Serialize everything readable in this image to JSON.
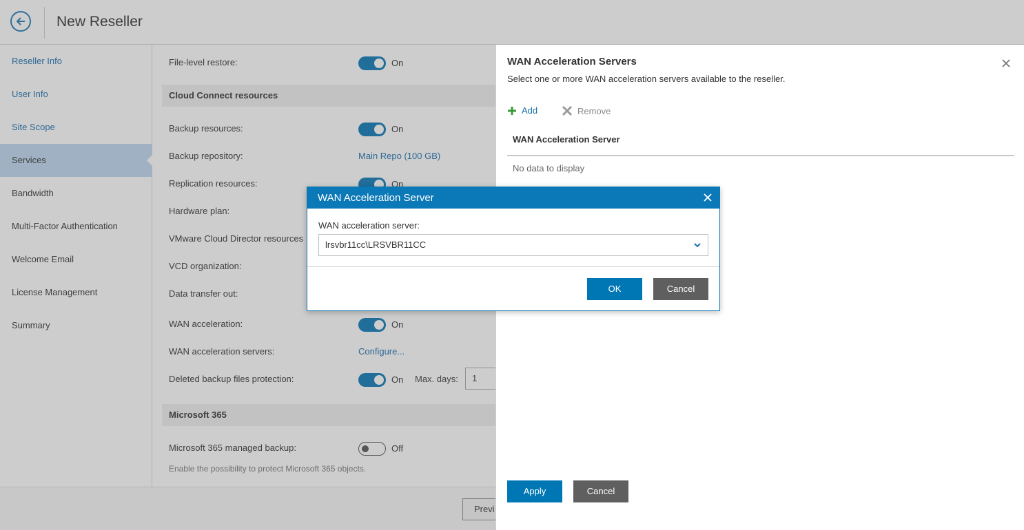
{
  "header": {
    "title": "New Reseller"
  },
  "sidebar": {
    "items": [
      {
        "label": "Reseller Info"
      },
      {
        "label": "User Info"
      },
      {
        "label": "Site Scope"
      },
      {
        "label": "Services"
      },
      {
        "label": "Bandwidth"
      },
      {
        "label": "Multi-Factor Authentication"
      },
      {
        "label": "Welcome Email"
      },
      {
        "label": "License Management"
      },
      {
        "label": "Summary"
      }
    ]
  },
  "form": {
    "file_level_restore": {
      "label": "File-level restore:",
      "state": "On"
    },
    "cloud_connect_header": "Cloud Connect resources",
    "backup_resources": {
      "label": "Backup resources:",
      "state": "On"
    },
    "backup_repository": {
      "label": "Backup repository:",
      "value": "Main Repo (100 GB)"
    },
    "replication_resources": {
      "label": "Replication resources:",
      "state": "On"
    },
    "hardware_plan": {
      "label": "Hardware plan:"
    },
    "vcd_resources": {
      "label": "VMware Cloud Director resources"
    },
    "vcd_organization": {
      "label": "VCD organization:"
    },
    "data_transfer_out": {
      "label": "Data transfer out:"
    },
    "wan_acceleration": {
      "label": "WAN acceleration:",
      "state": "On"
    },
    "wan_acceleration_servers": {
      "label": "WAN acceleration servers:",
      "link": "Configure..."
    },
    "deleted_backup_protection": {
      "label": "Deleted backup files protection:",
      "state": "On",
      "max_days_label": "Max. days:",
      "max_days_value": "1"
    },
    "m365_header": "Microsoft 365",
    "m365_managed_backup": {
      "label": "Microsoft 365 managed backup:",
      "state": "Off"
    },
    "m365_hint": "Enable the possibility to protect Microsoft 365 objects."
  },
  "footer": {
    "previous_label": "Previ"
  },
  "side_panel": {
    "title": "WAN Acceleration Servers",
    "description": "Select one or more WAN acceleration servers available to the reseller.",
    "add_label": "Add",
    "remove_label": "Remove",
    "column_header": "WAN Acceleration Server",
    "empty_text": "No data to display",
    "apply_label": "Apply",
    "cancel_label": "Cancel"
  },
  "dialog": {
    "title": "WAN Acceleration Server",
    "field_label": "WAN acceleration server:",
    "selected_value": "lrsvbr11cc\\LRSVBR11CC",
    "ok_label": "OK",
    "cancel_label": "Cancel"
  },
  "colors": {
    "accent": "#0b78b7",
    "toggle_on": "#0a78b8",
    "add_icon": "#3a9a3a",
    "secondary_button": "#5f5f5f"
  },
  "icons": [
    "back-arrow-icon",
    "close-icon",
    "plus-icon",
    "remove-x-icon",
    "chevron-down-icon"
  ]
}
